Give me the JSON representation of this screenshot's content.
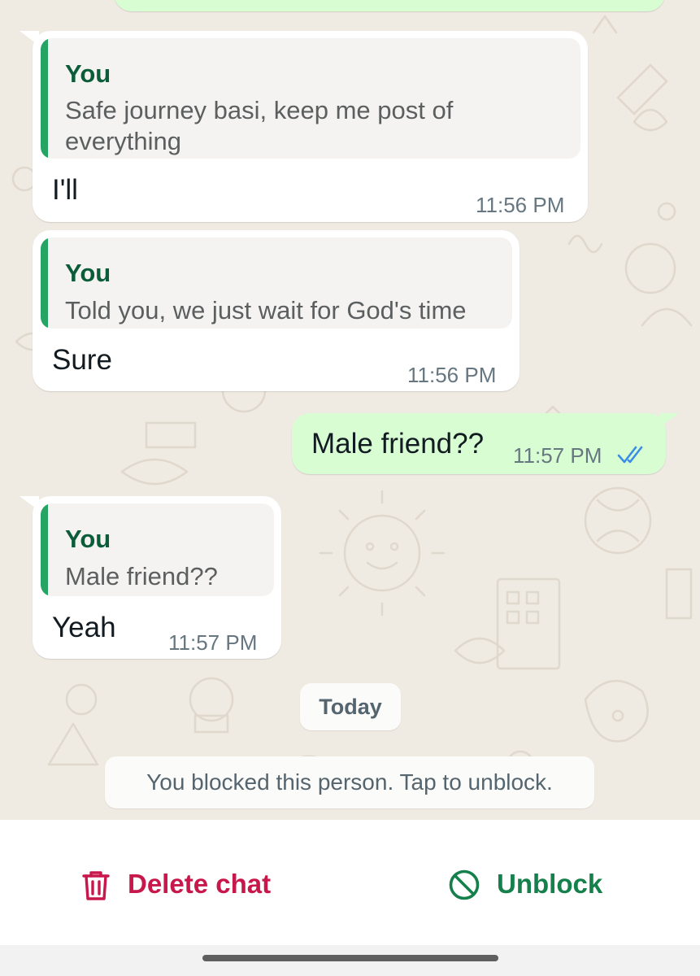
{
  "messages": [
    {
      "quote_author": "You",
      "quote_text": "Safe journey basi, keep me post of everything",
      "text": "I'll",
      "time": "11:56 PM"
    },
    {
      "quote_author": "You",
      "quote_text": "Told you, we just wait for God's time",
      "text": "Sure",
      "time": "11:56 PM"
    },
    {
      "text": "Male friend??",
      "time": "11:57 PM",
      "status_icon": "double-check-read-icon"
    },
    {
      "quote_author": "You",
      "quote_text": "Male friend??",
      "text": "Yeah",
      "time": "11:57 PM"
    }
  ],
  "date_separator": "Today",
  "system_notice": "You blocked this person. Tap to unblock.",
  "actions": {
    "delete": {
      "label": "Delete chat",
      "icon": "trash-icon",
      "color": "#c8174a"
    },
    "unblock": {
      "label": "Unblock",
      "icon": "block-icon",
      "color": "#15804b"
    }
  },
  "colors": {
    "chat_background": "#efeae2",
    "incoming_bubble": "#ffffff",
    "outgoing_bubble": "#d9fdd3",
    "quote_accent": "#25a464",
    "read_ticks": "#3a8ee6"
  }
}
